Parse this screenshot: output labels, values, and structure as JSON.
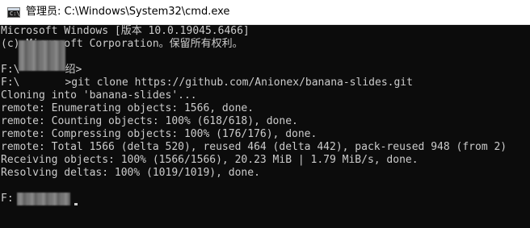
{
  "window": {
    "title": "管理员: C:\\Windows\\System32\\cmd.exe",
    "icon": "cmd-icon",
    "icon_prompt": "C:\\"
  },
  "console": {
    "lines": [
      "Microsoft Windows [版本 10.0.19045.6466]",
      "(c) Microsoft Corporation。保留所有权利。",
      "",
      "F:\\",
      "F:\\",
      "Cloning into 'banana-slides'...",
      "remote: Enumerating objects: 1566, done.",
      "remote: Counting objects: 100% (618/618), done.",
      "remote: Compressing objects: 100% (176/176), done.",
      "remote: Total 1566 (delta 520), reused 464 (delta 442), pack-reused 948 (from 2)",
      "Receiving objects: 100% (1566/1566), 20.23 MiB | 1.79 MiB/s, done.",
      "Resolving deltas: 100% (1019/1019), done.",
      "",
      "F:"
    ],
    "prompt_tail_1": "绍>",
    "command_tail": ">git clone https://github.com/Anionex/banana-slides.git",
    "colors": {
      "background": "#0c0c0c",
      "text": "#cccccc"
    }
  }
}
